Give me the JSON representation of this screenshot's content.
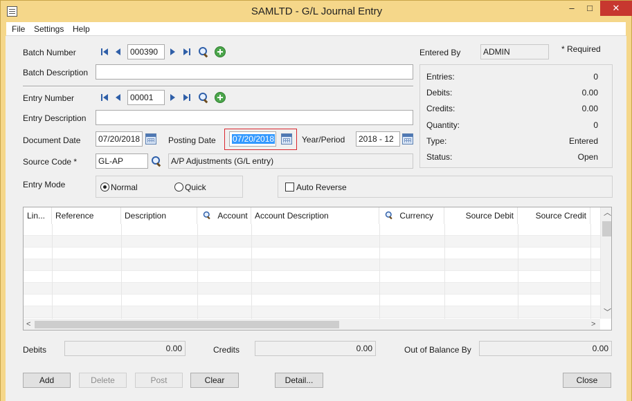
{
  "window": {
    "title": "SAMLTD - G/L Journal Entry",
    "min": "–",
    "max": "□",
    "close": "✕"
  },
  "menu": [
    "File",
    "Settings",
    "Help"
  ],
  "batch": {
    "label": "Batch Number",
    "value": "000390",
    "desc_label": "Batch Description",
    "desc_value": ""
  },
  "entry": {
    "label": "Entry Number",
    "value": "00001",
    "desc_label": "Entry Description",
    "desc_value": ""
  },
  "dates": {
    "document_label": "Document Date",
    "document_value": "07/20/2018",
    "posting_label": "Posting Date",
    "posting_value": "07/20/2018",
    "year_period_label": "Year/Period",
    "year_period_value": "2018 - 12"
  },
  "source": {
    "label": "Source Code *",
    "code": "GL-AP",
    "description": "A/P Adjustments (G/L entry)"
  },
  "entry_mode": {
    "label": "Entry Mode",
    "options": [
      "Normal",
      "Quick"
    ],
    "selected": "Normal"
  },
  "auto_reverse": {
    "label": "Auto Reverse",
    "checked": false
  },
  "entered_by": {
    "label": "Entered By",
    "value": "ADMIN"
  },
  "required_note": "*  Required",
  "summary": [
    {
      "label": "Entries:",
      "value": "0"
    },
    {
      "label": "Debits:",
      "value": "0.00"
    },
    {
      "label": "Credits:",
      "value": "0.00"
    },
    {
      "label": "Quantity:",
      "value": "0"
    },
    {
      "label": "Type:",
      "value": "Entered"
    },
    {
      "label": "Status:",
      "value": "Open"
    }
  ],
  "grid": {
    "columns": [
      "Lin...",
      "Reference",
      "Description",
      "Account",
      "Account Description",
      "Currency",
      "Source Debit",
      "Source Credit"
    ],
    "rows": []
  },
  "totals": {
    "debits_label": "Debits",
    "debits_value": "0.00",
    "credits_label": "Credits",
    "credits_value": "0.00",
    "oob_label": "Out of Balance By",
    "oob_value": "0.00"
  },
  "buttons": {
    "add": "Add",
    "delete": "Delete",
    "post": "Post",
    "clear": "Clear",
    "detail": "Detail...",
    "close": "Close"
  },
  "colors": {
    "titlebar": "#f5d78a",
    "close_button": "#c7372f",
    "selection": "#3399ff",
    "focus_border": "#d9262e",
    "nav_icons": "#2f5fa8"
  }
}
